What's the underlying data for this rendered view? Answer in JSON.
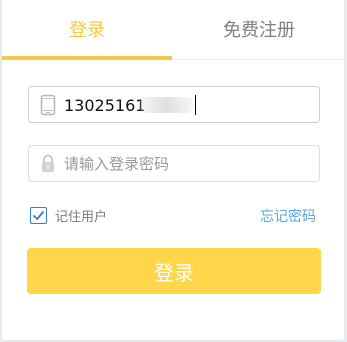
{
  "tabs": {
    "login_label": "登录",
    "register_label": "免费注册"
  },
  "form": {
    "phone_value": "13025161",
    "password_placeholder": "请输入登录密码",
    "remember_label": "记住用户",
    "remember_checked": true,
    "forgot_label": "忘记密码",
    "submit_label": "登录"
  },
  "colors": {
    "accent": "#f5c84a",
    "button": "#ffd54a",
    "link": "#5aa4df",
    "checkbox": "#3a7bd5"
  },
  "icons": {
    "phone": "phone-icon",
    "password": "lock-icon",
    "checkbox": "check-icon"
  }
}
